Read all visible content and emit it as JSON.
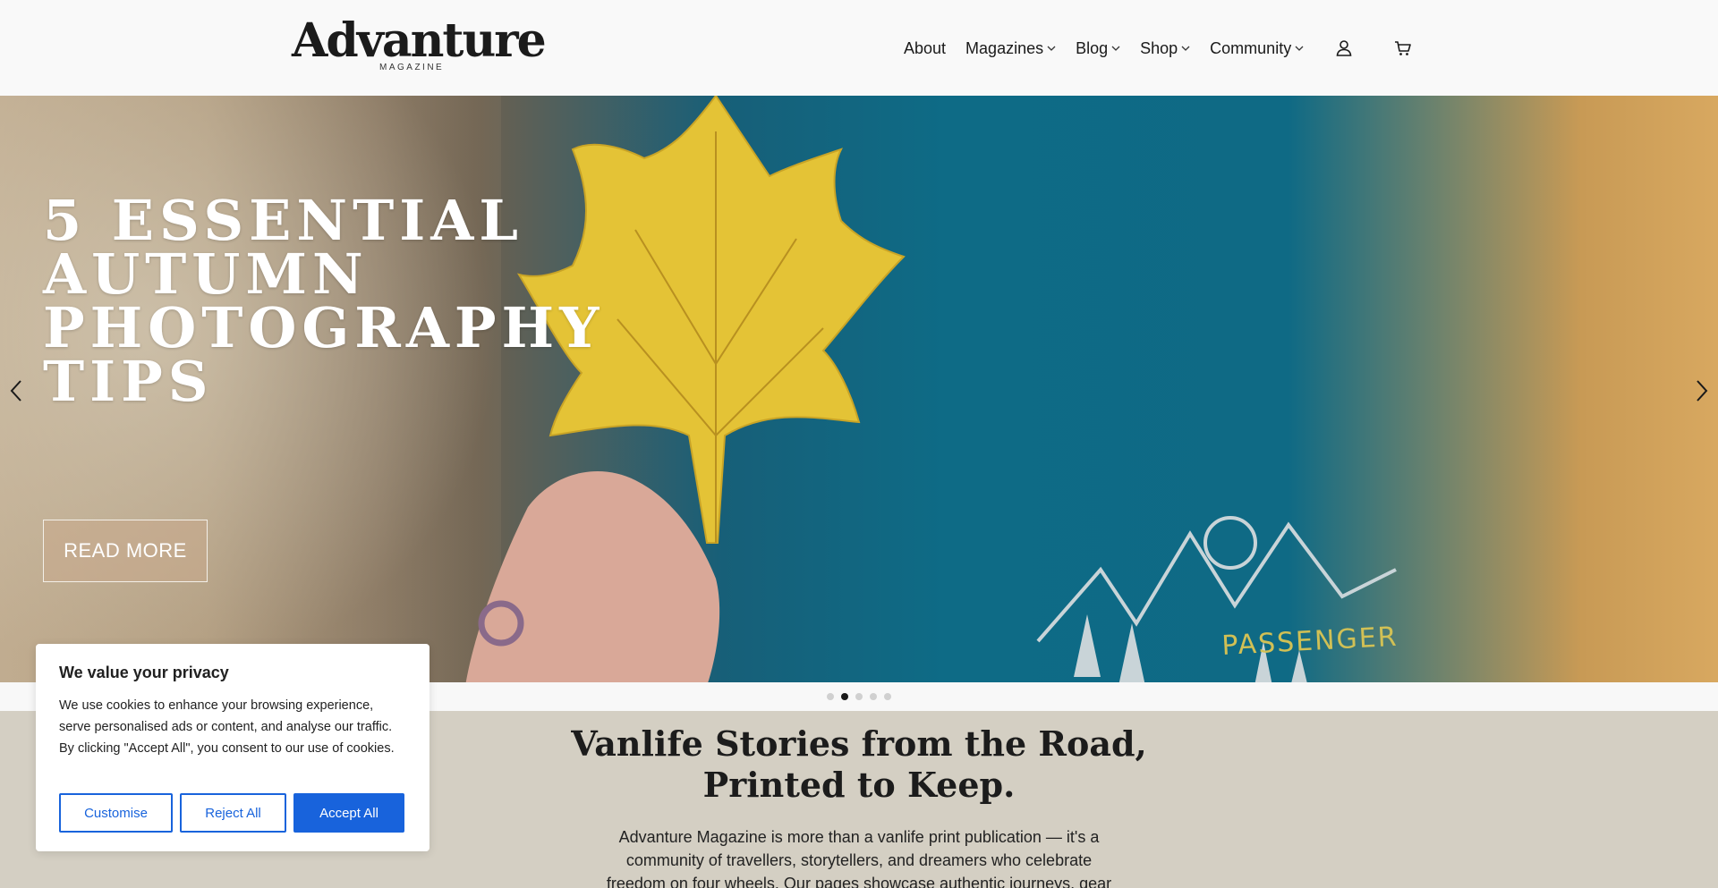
{
  "brand": {
    "name": "Advanture",
    "tagline": "MAGAZINE"
  },
  "nav": {
    "items": [
      {
        "label": "About",
        "has_dropdown": false
      },
      {
        "label": "Magazines",
        "has_dropdown": true
      },
      {
        "label": "Blog",
        "has_dropdown": true
      },
      {
        "label": "Shop",
        "has_dropdown": true
      },
      {
        "label": "Community",
        "has_dropdown": true
      }
    ],
    "icons": [
      "account-icon",
      "cart-icon"
    ]
  },
  "hero": {
    "title_lines": [
      "5 ESSENTIAL",
      "AUTUMN",
      "PHOTOGRAPHY",
      "TIPS"
    ],
    "cta_label": "READ MORE",
    "shirt_text": "PASSENGER",
    "slides_total": 5,
    "active_slide": 2
  },
  "intro": {
    "title_line1": "Vanlife Stories from the Road,",
    "title_line2": "Printed to Keep.",
    "text_line1": "Advanture Magazine is more than a vanlife print publication — it's a",
    "text_line2": "community of travellers, storytellers, and dreamers who celebrate",
    "text_line3": "freedom on four wheels. Our pages showcase authentic journeys, gear"
  },
  "cookie": {
    "title": "We value your privacy",
    "text": "We use cookies to enhance your browsing experience, serve personalised ads or content, and analyse our traffic. By clicking \"Accept All\", you consent to our use of cookies.",
    "customise_label": "Customise",
    "reject_label": "Reject All",
    "accept_label": "Accept All"
  },
  "colors": {
    "accent": "#1863dc",
    "intro_bg": "#d4cfc3",
    "header_bg": "#f9f9f9"
  }
}
